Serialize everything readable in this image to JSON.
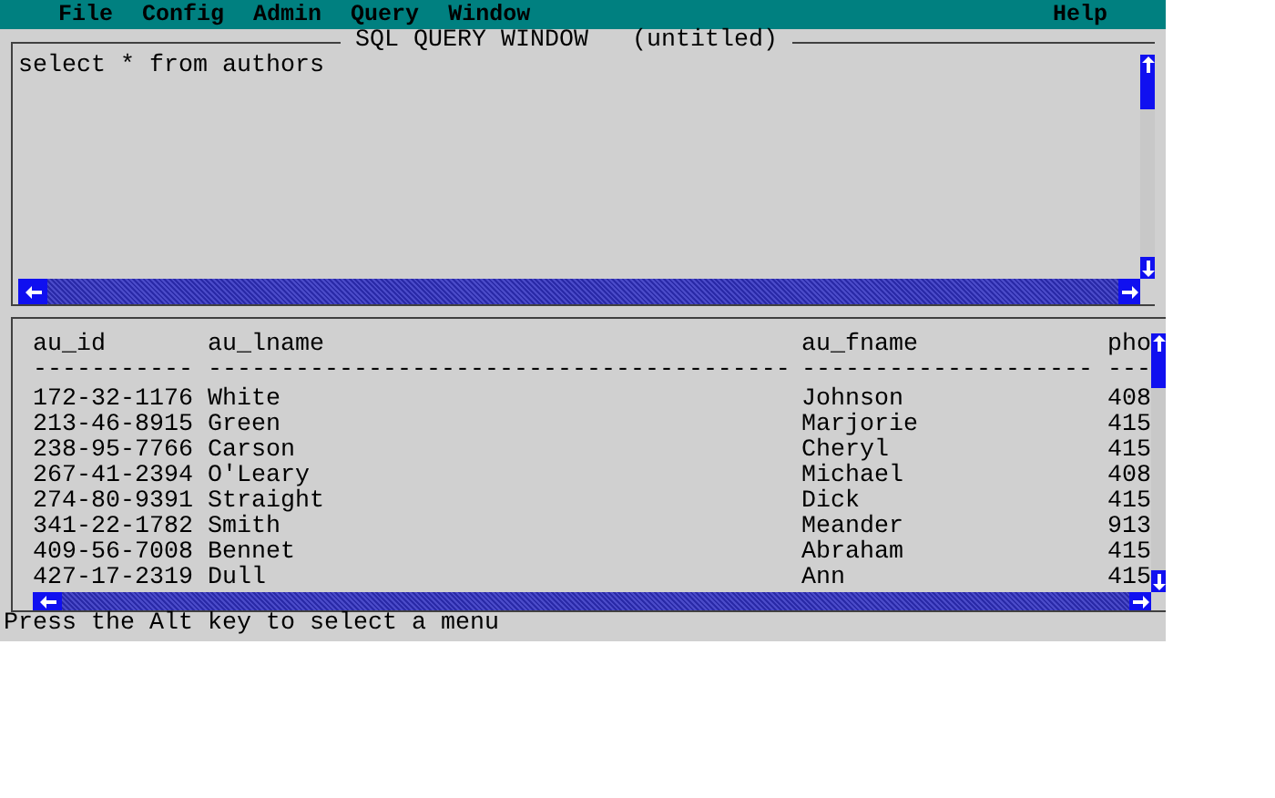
{
  "menu_bar": {
    "items": [
      "File",
      "Config",
      "Admin",
      "Query",
      "Window"
    ],
    "help": "Help"
  },
  "query_window": {
    "title": "SQL QUERY WINDOW",
    "subtitle": "(untitled)",
    "text": "select * from authors"
  },
  "results": {
    "columns": [
      "au_id",
      "au_lname",
      "au_fname",
      "pho"
    ],
    "separators": [
      "-----------",
      "----------------------------------------",
      "--------------------",
      "---"
    ],
    "rows": [
      [
        "172-32-1176",
        "White",
        "Johnson",
        "408"
      ],
      [
        "213-46-8915",
        "Green",
        "Marjorie",
        "415"
      ],
      [
        "238-95-7766",
        "Carson",
        "Cheryl",
        "415"
      ],
      [
        "267-41-2394",
        "O'Leary",
        "Michael",
        "408"
      ],
      [
        "274-80-9391",
        "Straight",
        "Dick",
        "415"
      ],
      [
        "341-22-1782",
        "Smith",
        "Meander",
        "913"
      ],
      [
        "409-56-7008",
        "Bennet",
        "Abraham",
        "415"
      ],
      [
        "427-17-2319",
        "Dull",
        "Ann",
        "415"
      ]
    ]
  },
  "status_bar": "Press the Alt key to select a menu"
}
